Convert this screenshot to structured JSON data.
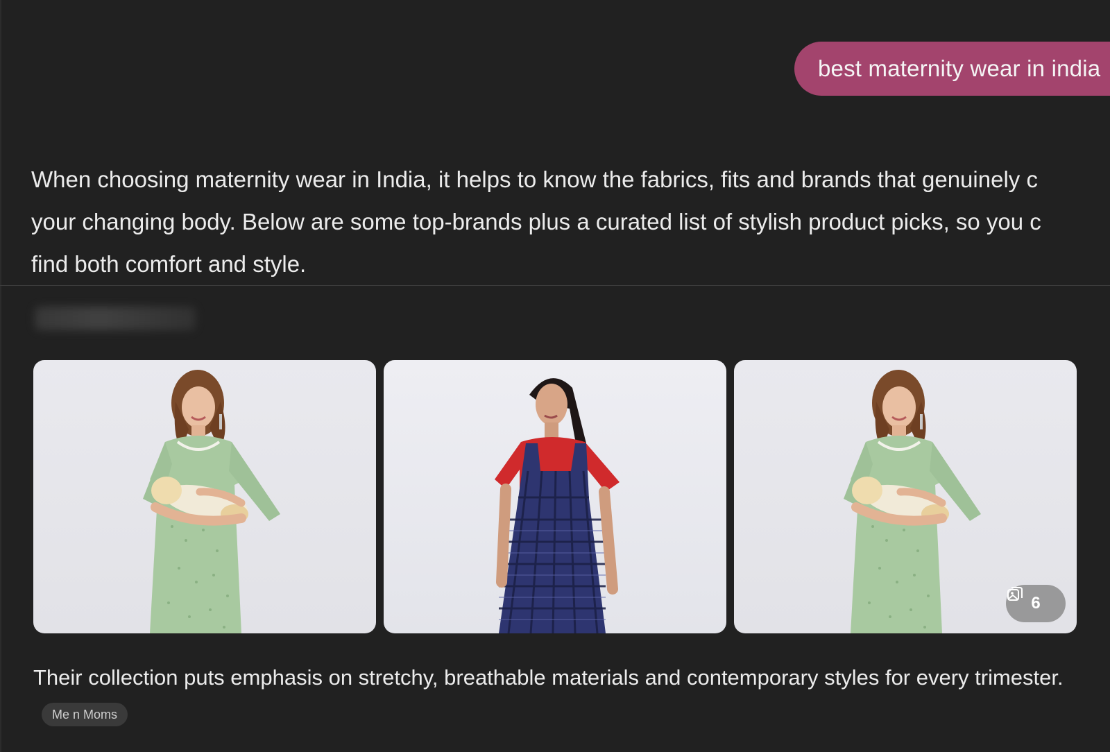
{
  "conversation": {
    "user_message": "best maternity wear in india",
    "intro_lines": [
      "When choosing maternity wear in India, it helps to know the fabrics, fits and brands that genuinely c",
      "your changing body. Below are some top-brands plus a curated list of stylish product picks, so you c",
      "find both comfort and style."
    ],
    "gallery": {
      "images": [
        {
          "alt": "Woman in green printed dress holding a baby"
        },
        {
          "alt": "Woman in red top with navy checked pinafore dress"
        },
        {
          "alt": "Woman in green printed dress holding a baby"
        }
      ],
      "count_icon": "gallery-icon",
      "count": "6"
    },
    "description": "Their collection puts emphasis on stretchy, breathable materials and contemporary styles for every trimester.",
    "source_chip": "Me n Moms"
  },
  "colors": {
    "background": "#212121",
    "user_bubble": "#a3446d",
    "text": "#ececec"
  }
}
